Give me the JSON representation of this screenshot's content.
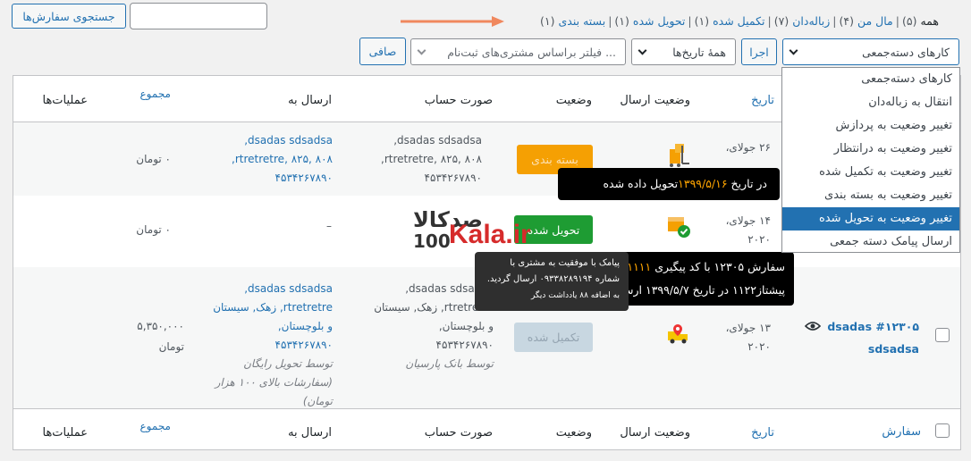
{
  "search": {
    "button_label": "جستجوی سفارش‌ها",
    "input_value": ""
  },
  "status_filters": [
    {
      "label": "همه",
      "count": "(۵)",
      "current": true
    },
    {
      "label": "مال من",
      "count": "(۴)"
    },
    {
      "label": "زباله‌دان",
      "count": "(۷)"
    },
    {
      "label": "تکمیل شده",
      "count": "(۱)"
    },
    {
      "label": "تحویل شده",
      "count": "(۱)"
    },
    {
      "label": "بسته بندی",
      "count": "(۱)"
    }
  ],
  "toolbar": {
    "bulk_select_label": "کارهای دسته‌جمعی",
    "apply_label": "اجرا",
    "dates_select_label": "همهٔ تاریخ‌ها",
    "customer_filter_placeholder": "فیلتر براساس مشتری‌های ثبت‌نام ...",
    "filter_label": "صافی"
  },
  "bulk_options": [
    "کارهای دسته‌جمعی",
    "انتقال به زباله‌دان",
    "تغییر وضعیت به پردازش",
    "تغییر وضعیت به درانتظار",
    "تغییر وضعیت به تکمیل شده",
    "تغییر وضعیت به بسته بندی",
    "تغییر وضعیت به تحویل شده",
    "ارسال پیامک دسته جمعی"
  ],
  "bulk_highlighted_index": 6,
  "columns": {
    "order": "سفارش",
    "date": "تاریخ",
    "shipping_status": "وضعیت ارسال",
    "status": "وضعیت",
    "billing": "صورت حساب",
    "ship_to": "ارسال به",
    "total": "مجموع",
    "actions": "عملیات‌ها"
  },
  "rows": [
    {
      "date_line1": "۲۶ جولای،",
      "status": "بسته بندی",
      "billing": [
        "dsadas sdsadsa,",
        "rtretretre, ۸۲۵, ۸۰۸,",
        "۴۵۳۴۲۶۷۸۹۰"
      ],
      "ship": [
        "dsadas sdsadsa,",
        "rtretretre, ۸۲۵, ۸۰۸,",
        "۴۵۳۴۲۶۷۸۹۰"
      ],
      "total": "۰ تومان"
    },
    {
      "date_line1": "۱۴ جولای،",
      "date_line2": "۲۰۲۰",
      "status": "تحویل شده",
      "billing": [
        "–"
      ],
      "ship": [
        "–"
      ],
      "total": "۰ تومان"
    },
    {
      "order_label": "#۱۲۳۰۵ dsadas",
      "order_label2": "sdsadsa",
      "date_line1": "۱۳ جولای،",
      "date_line2": "۲۰۲۰",
      "status": "تکمیل شده",
      "billing": [
        "dsadas sdsadsa,",
        "rtretretre, زهک, سیستان",
        "و بلوچستان,",
        "۴۵۳۴۲۶۷۸۹۰"
      ],
      "billing_note": "توسط بانک پارسیان",
      "ship": [
        "dsadas sdsadsa,",
        "rtretretre, زهک, سیستان",
        "و بلوچستان,",
        "۴۵۳۴۲۶۷۸۹۰"
      ],
      "ship_note": [
        "توسط تحویل رایگان",
        "(سفارشات بالای ۱۰۰ هزار",
        "تومان)"
      ],
      "total": [
        "۵,۳۵۰,۰۰۰",
        "تومان"
      ]
    }
  ],
  "tooltips": {
    "delivered_prefix": "در تاریخ",
    "delivered_date": "۱۳۹۹/۵/۱۶",
    "delivered_suffix": "تحویل داده شده",
    "tracking_prefix": "سفارش ۱۲۳۰۵ با کد پیگیری",
    "tracking_code": "۱۱۱۱",
    "tracking_line2": "پیشتاز۱۱۲۲ در تاریخ ۱۳۹۹/۵/۷ ارسال",
    "sms_line1": "پیامک با موفقیت به مشتری با",
    "sms_line2": "شماره ۰۹۳۳۸۲۸۹۱۹۴ ارسال گردید.",
    "sms_line3": "به اضافه ۸۸ یادداشت دیگر"
  },
  "watermark": {
    "brand": "Kala.ir",
    "prefix": "100",
    "persian": "صدکالا"
  },
  "colors": {
    "accent": "#2271b1",
    "packing": "#f5a003",
    "delivered": "#1e9c33",
    "completed": "#c6e1c6",
    "tooltip_date": "#ffa500"
  }
}
